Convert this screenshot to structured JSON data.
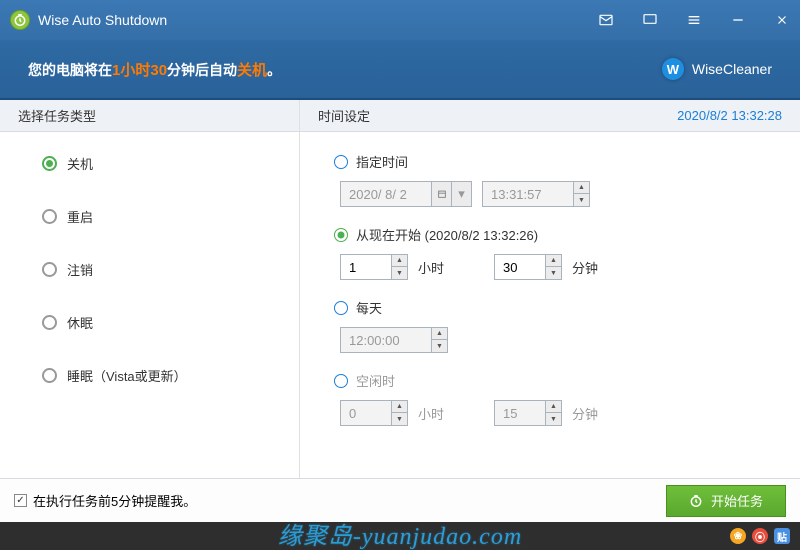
{
  "titlebar": {
    "title": "Wise Auto Shutdown"
  },
  "banner": {
    "prefix": "您的电脑将在",
    "hours_num": "1",
    "hours_unit": "小时",
    "mins_num": "30",
    "mins_unit": "分钟后自动",
    "action": "关机",
    "period": "。",
    "brand": "WiseCleaner",
    "brand_initial": "W"
  },
  "left": {
    "header": "选择任务类型",
    "tasks": [
      {
        "label": "关机",
        "selected": true
      },
      {
        "label": "重启",
        "selected": false
      },
      {
        "label": "注销",
        "selected": false
      },
      {
        "label": "休眠",
        "selected": false
      },
      {
        "label": "睡眠（Vista或更新）",
        "selected": false
      }
    ]
  },
  "right": {
    "header": "时间设定",
    "clock": "2020/8/2 13:32:28",
    "opt_specified": {
      "label": "指定时间",
      "date": "2020/ 8/ 2",
      "time": "13:31:57"
    },
    "opt_fromnow": {
      "label": "从现在开始 (2020/8/2 13:32:26)",
      "hours": "1",
      "hours_unit": "小时",
      "mins": "30",
      "mins_unit": "分钟"
    },
    "opt_daily": {
      "label": "每天",
      "time": "12:00:00"
    },
    "opt_idle": {
      "label": "空闲时",
      "hours": "0",
      "hours_unit": "小时",
      "mins": "15",
      "mins_unit": "分钟"
    }
  },
  "bottom": {
    "remind": "在执行任务前5分钟提醒我。",
    "start": "开始任务"
  },
  "watermark": "缘聚岛-yuanjudao.com",
  "footer_icons": {
    "y": "❀",
    "r": "⦿",
    "b": "贴"
  }
}
